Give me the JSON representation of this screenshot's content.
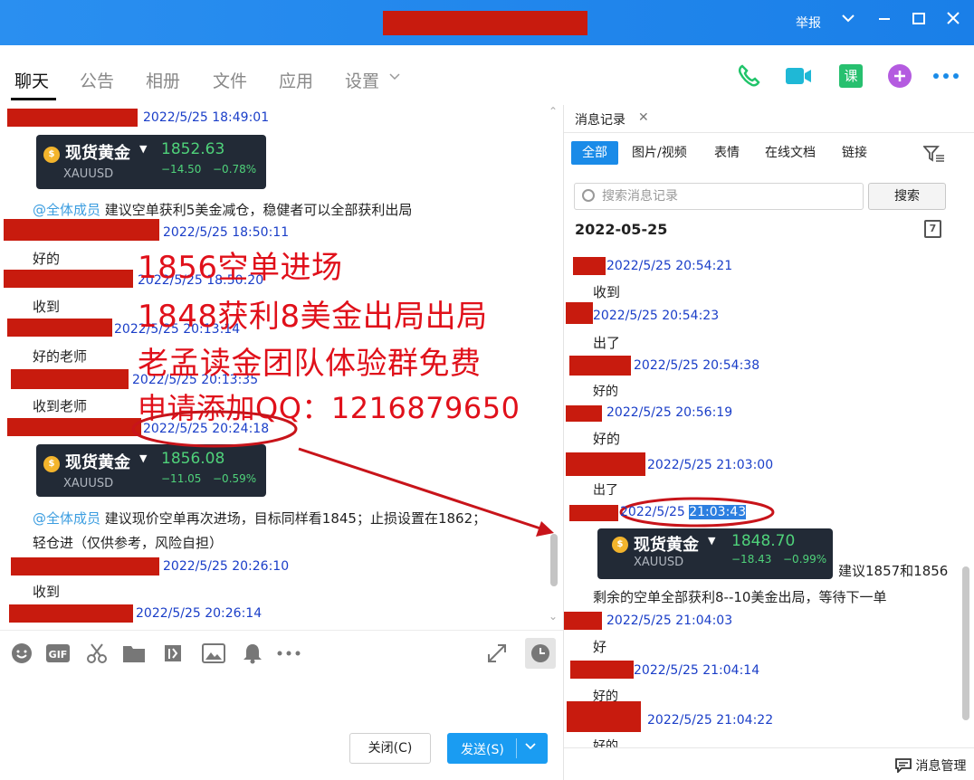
{
  "window": {
    "report": "举报",
    "colors": {
      "titlebar": "#1a8be8",
      "redaction": "#c81b0e",
      "overlay_text": "#e0101a",
      "timestamp": "#1a3ec8",
      "price_up": "#4fd27a"
    }
  },
  "nav": {
    "tabs": [
      {
        "label": "聊天"
      },
      {
        "label": "公告"
      },
      {
        "label": "相册"
      },
      {
        "label": "文件"
      },
      {
        "label": "应用"
      },
      {
        "label": "设置"
      }
    ],
    "icons": [
      "phone-icon",
      "video-icon",
      "course-icon",
      "plus-icon",
      "more-icon"
    ],
    "course_label": "课"
  },
  "chat": {
    "messages": [
      {
        "time": "2022/5/25 18:49:01"
      },
      {
        "card": {
          "name": "现货黄金",
          "symbol": "XAUUSD",
          "price": "1852.63",
          "change": "−14.50",
          "pct": "−0.78%"
        }
      },
      {
        "mention": "@全体成员",
        "text": "建议空单获利5美金减仓，稳健者可以全部获利出局"
      },
      {
        "time": "2022/5/25 18:50:11"
      },
      {
        "text": "好的"
      },
      {
        "time": "2022/5/25 18:50:20"
      },
      {
        "text": "收到"
      },
      {
        "time": "2022/5/25 20:13:14"
      },
      {
        "text": "好的老师"
      },
      {
        "time": "2022/5/25 20:13:35"
      },
      {
        "text": "收到老师"
      },
      {
        "time": "2022/5/25 20:24:18"
      },
      {
        "card": {
          "name": "现货黄金",
          "symbol": "XAUUSD",
          "price": "1856.08",
          "change": "−11.05",
          "pct": "−0.59%"
        }
      },
      {
        "mention": "@全体成员",
        "text": "建议现价空单再次进场，目标同样看1845；止损设置在1862；",
        "text2": "轻仓进（仅供参考，风险自担）"
      },
      {
        "time": "2022/5/25 20:26:10"
      },
      {
        "text": "收到"
      },
      {
        "time": "2022/5/25 20:26:14"
      }
    ]
  },
  "overlay": {
    "lines": [
      "1856空单进场",
      "1848获利8美金出局出局",
      "老孟读金团队体验群免费",
      "申请添加QQ：1216879650"
    ]
  },
  "composer": {
    "close_label": "关闭(C)",
    "send_label": "发送(S)"
  },
  "history": {
    "tab_label": "消息记录",
    "filters": [
      "全部",
      "图片/视频",
      "表情",
      "在线文档",
      "链接"
    ],
    "search_placeholder": "搜索消息记录",
    "search_button": "搜索",
    "date": "2022-05-25",
    "entries": [
      {
        "time": "2022/5/25 20:54:21"
      },
      {
        "text": "收到"
      },
      {
        "time": "2022/5/25 20:54:23"
      },
      {
        "text": "出了"
      },
      {
        "time": "2022/5/25 20:54:38"
      },
      {
        "text": "好的"
      },
      {
        "time": "2022/5/25 20:56:19"
      },
      {
        "text": "好的"
      },
      {
        "time": "2022/5/25 21:03:00"
      },
      {
        "text": "出了"
      },
      {
        "time_a": "2022/5/25 ",
        "time_b": "21:03:43"
      },
      {
        "card": {
          "name": "现货黄金",
          "symbol": "XAUUSD",
          "price": "1848.70",
          "change": "−18.43",
          "pct": "−0.99%"
        },
        "text": "建议1857和1856"
      },
      {
        "text": "剩余的空单全部获利8--10美金出局，等待下一单"
      },
      {
        "time": "2022/5/25 21:04:03"
      },
      {
        "text": "好"
      },
      {
        "time": "2022/5/25 21:04:14"
      },
      {
        "text": "好的"
      },
      {
        "time": "2022/5/25 21:04:22"
      },
      {
        "text": "好的"
      }
    ],
    "manage_label": "消息管理"
  }
}
